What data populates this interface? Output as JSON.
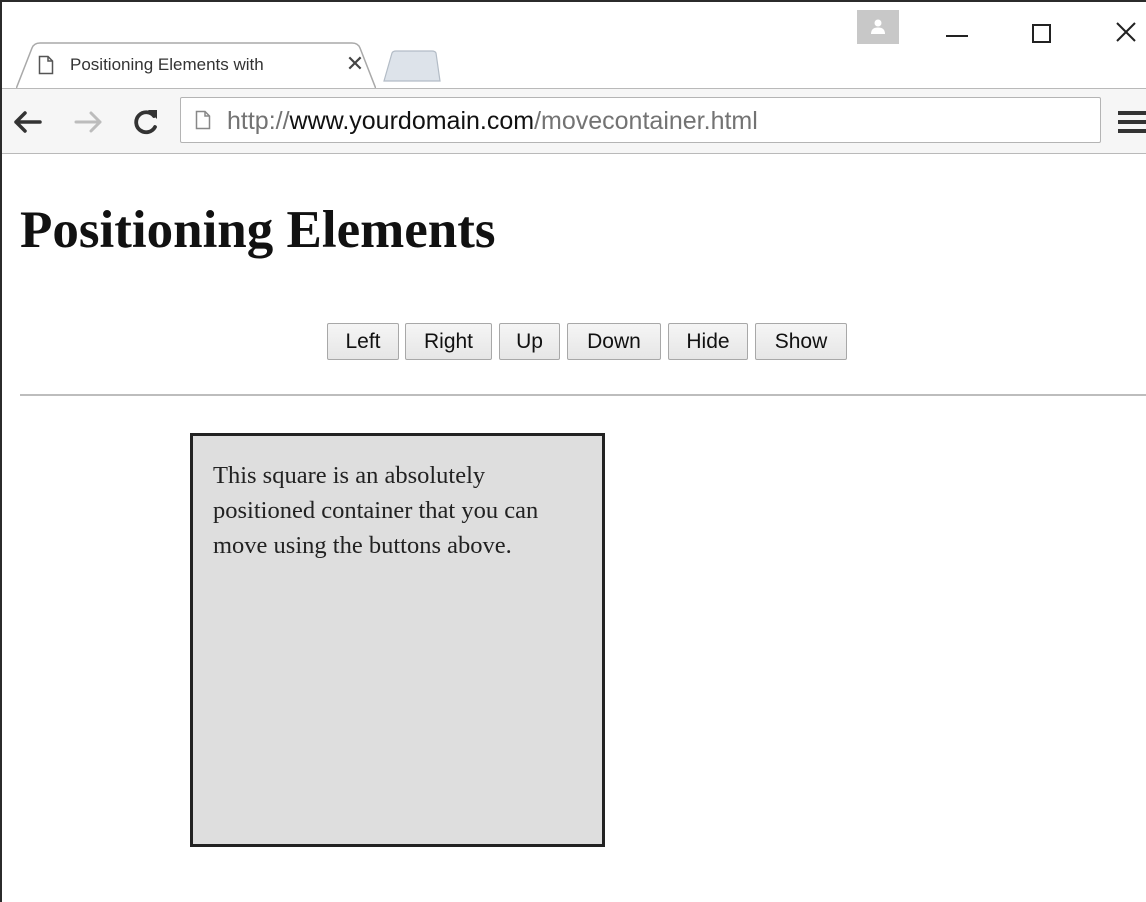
{
  "browser": {
    "tab": {
      "title": "Positioning Elements with",
      "close_glyph": "✕"
    },
    "address_bar": {
      "url_scheme": "http://",
      "url_host": "www.yourdomain.com",
      "url_path": "/movecontainer.html"
    },
    "icons": [
      "page-icon",
      "close-icon",
      "new-tab-icon",
      "profile-icon",
      "minimize-icon",
      "maximize-icon",
      "window-close-icon",
      "back-icon",
      "forward-icon",
      "reload-icon",
      "menu-icon"
    ]
  },
  "page": {
    "heading": "Positioning Elements",
    "buttons": {
      "left": "Left",
      "right": "Right",
      "up": "Up",
      "down": "Down",
      "hide": "Hide",
      "show": "Show"
    },
    "container_text": "This square is an absolutely positioned container that you can move using the buttons above."
  },
  "colors": {
    "container_background": "#dedede",
    "container_border": "#222222",
    "url_dim": "#737373"
  }
}
